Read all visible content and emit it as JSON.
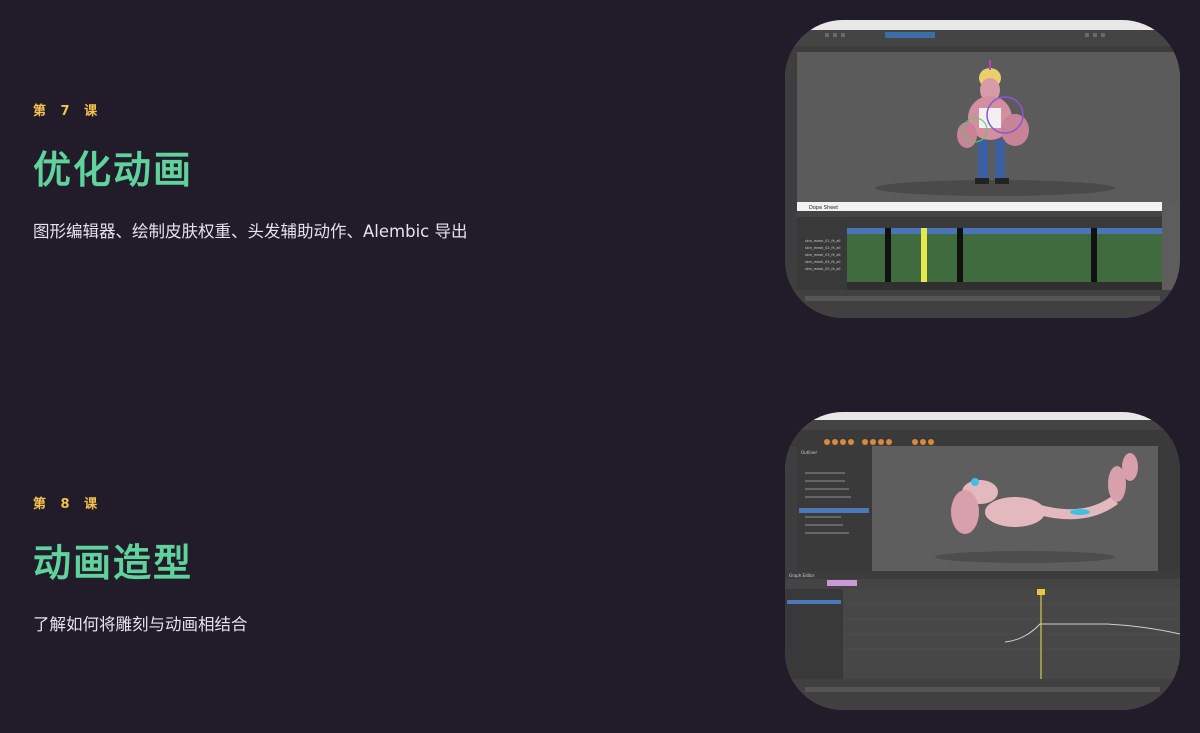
{
  "lessons": [
    {
      "number": "第 7 课",
      "title": "优化动画",
      "description": "图形编辑器、绘制皮肤权重、头发辅助动作、Alembic 导出",
      "screenshot": {
        "panel_title": "Dope Sheet",
        "tracks": [
          "skin_mesh_01_fk_all",
          "skin_mesh_02_fk_all",
          "skin_mesh_03_fk_all",
          "skin_mesh_04_fk_all",
          "skin_mesh_05_fk_all"
        ]
      }
    },
    {
      "number": "第 8 课",
      "title": "动画造型",
      "description": "了解如何将雕刻与动画相结合",
      "screenshot": {
        "panel_title": "Graph Editor",
        "outliner_label": "Outliner"
      }
    }
  ],
  "colors": {
    "background": "#211b2a",
    "lesson_number": "#f4c24d",
    "lesson_title": "#5fd39b",
    "description": "#e6e2ec"
  }
}
